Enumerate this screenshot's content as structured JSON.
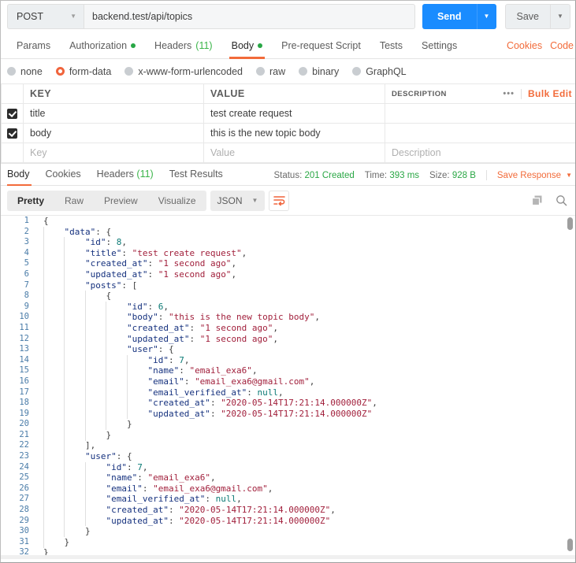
{
  "request": {
    "method": "POST",
    "url": "backend.test/api/topics",
    "send_label": "Send",
    "save_label": "Save",
    "tabs": [
      {
        "label": "Params",
        "active": false,
        "dot": false,
        "count": null
      },
      {
        "label": "Authorization",
        "active": false,
        "dot": true,
        "count": null
      },
      {
        "label": "Headers",
        "active": false,
        "dot": false,
        "count": "(11)"
      },
      {
        "label": "Body",
        "active": true,
        "dot": true,
        "count": null
      },
      {
        "label": "Pre-request Script",
        "active": false,
        "dot": false,
        "count": null
      },
      {
        "label": "Tests",
        "active": false,
        "dot": false,
        "count": null
      },
      {
        "label": "Settings",
        "active": false,
        "dot": false,
        "count": null
      }
    ],
    "links": [
      {
        "label": "Cookies"
      },
      {
        "label": "Code"
      }
    ],
    "body_types": [
      {
        "label": "none",
        "selected": false
      },
      {
        "label": "form-data",
        "selected": true
      },
      {
        "label": "x-www-form-urlencoded",
        "selected": false
      },
      {
        "label": "raw",
        "selected": false
      },
      {
        "label": "binary",
        "selected": false
      },
      {
        "label": "GraphQL",
        "selected": false
      }
    ],
    "table": {
      "headers": [
        "KEY",
        "VALUE",
        "DESCRIPTION"
      ],
      "bulk_edit_label": "Bulk Edit",
      "dots_label": "•••",
      "rows": [
        {
          "checked": true,
          "key": "title",
          "value": "test create request",
          "description": ""
        },
        {
          "checked": true,
          "key": "body",
          "value": "this is the new topic body",
          "description": ""
        }
      ],
      "placeholder_row": {
        "key": "Key",
        "value": "Value",
        "description": "Description"
      }
    }
  },
  "response": {
    "tabs": [
      {
        "label": "Body",
        "active": true,
        "count": null
      },
      {
        "label": "Cookies",
        "active": false,
        "count": null
      },
      {
        "label": "Headers",
        "active": false,
        "count": "(11)"
      },
      {
        "label": "Test Results",
        "active": false,
        "count": null
      }
    ],
    "meta": {
      "status_label": "Status:",
      "status_value": "201 Created",
      "time_label": "Time:",
      "time_value": "393 ms",
      "size_label": "Size:",
      "size_value": "928 B",
      "save_response_label": "Save Response"
    },
    "view_modes": [
      {
        "label": "Pretty",
        "active": true
      },
      {
        "label": "Raw",
        "active": false
      },
      {
        "label": "Preview",
        "active": false
      },
      {
        "label": "Visualize",
        "active": false
      }
    ],
    "format": "JSON",
    "code_lines": [
      {
        "n": 1,
        "indent": 0,
        "html": "<span class='tok-pun'>{</span>"
      },
      {
        "n": 2,
        "indent": 1,
        "html": "<span class='tok-key'>\"data\"</span><span class='tok-pun'>: {</span>"
      },
      {
        "n": 3,
        "indent": 2,
        "html": "<span class='tok-key'>\"id\"</span><span class='tok-pun'>: </span><span class='tok-num'>8</span><span class='tok-pun'>,</span>"
      },
      {
        "n": 4,
        "indent": 2,
        "html": "<span class='tok-key'>\"title\"</span><span class='tok-pun'>: </span><span class='tok-str'>\"test create request\"</span><span class='tok-pun'>,</span>"
      },
      {
        "n": 5,
        "indent": 2,
        "html": "<span class='tok-key'>\"created_at\"</span><span class='tok-pun'>: </span><span class='tok-str'>\"1 second ago\"</span><span class='tok-pun'>,</span>"
      },
      {
        "n": 6,
        "indent": 2,
        "html": "<span class='tok-key'>\"updated_at\"</span><span class='tok-pun'>: </span><span class='tok-str'>\"1 second ago\"</span><span class='tok-pun'>,</span>"
      },
      {
        "n": 7,
        "indent": 2,
        "html": "<span class='tok-key'>\"posts\"</span><span class='tok-pun'>: [</span>"
      },
      {
        "n": 8,
        "indent": 3,
        "html": "<span class='tok-pun'>{</span>"
      },
      {
        "n": 9,
        "indent": 4,
        "html": "<span class='tok-key'>\"id\"</span><span class='tok-pun'>: </span><span class='tok-num'>6</span><span class='tok-pun'>,</span>"
      },
      {
        "n": 10,
        "indent": 4,
        "html": "<span class='tok-key'>\"body\"</span><span class='tok-pun'>: </span><span class='tok-str'>\"this is the new topic body\"</span><span class='tok-pun'>,</span>"
      },
      {
        "n": 11,
        "indent": 4,
        "html": "<span class='tok-key'>\"created_at\"</span><span class='tok-pun'>: </span><span class='tok-str'>\"1 second ago\"</span><span class='tok-pun'>,</span>"
      },
      {
        "n": 12,
        "indent": 4,
        "html": "<span class='tok-key'>\"updated_at\"</span><span class='tok-pun'>: </span><span class='tok-str'>\"1 second ago\"</span><span class='tok-pun'>,</span>"
      },
      {
        "n": 13,
        "indent": 4,
        "html": "<span class='tok-key'>\"user\"</span><span class='tok-pun'>: {</span>"
      },
      {
        "n": 14,
        "indent": 5,
        "html": "<span class='tok-key'>\"id\"</span><span class='tok-pun'>: </span><span class='tok-num'>7</span><span class='tok-pun'>,</span>"
      },
      {
        "n": 15,
        "indent": 5,
        "html": "<span class='tok-key'>\"name\"</span><span class='tok-pun'>: </span><span class='tok-str'>\"email_exa6\"</span><span class='tok-pun'>,</span>"
      },
      {
        "n": 16,
        "indent": 5,
        "html": "<span class='tok-key'>\"email\"</span><span class='tok-pun'>: </span><span class='tok-str'>\"email_exa6@gmail.com\"</span><span class='tok-pun'>,</span>"
      },
      {
        "n": 17,
        "indent": 5,
        "html": "<span class='tok-key'>\"email_verified_at\"</span><span class='tok-pun'>: </span><span class='tok-null'>null</span><span class='tok-pun'>,</span>"
      },
      {
        "n": 18,
        "indent": 5,
        "html": "<span class='tok-key'>\"created_at\"</span><span class='tok-pun'>: </span><span class='tok-str'>\"2020-05-14T17:21:14.000000Z\"</span><span class='tok-pun'>,</span>"
      },
      {
        "n": 19,
        "indent": 5,
        "html": "<span class='tok-key'>\"updated_at\"</span><span class='tok-pun'>: </span><span class='tok-str'>\"2020-05-14T17:21:14.000000Z\"</span>"
      },
      {
        "n": 20,
        "indent": 4,
        "html": "<span class='tok-pun'>}</span>"
      },
      {
        "n": 21,
        "indent": 3,
        "html": "<span class='tok-pun'>}</span>"
      },
      {
        "n": 22,
        "indent": 2,
        "html": "<span class='tok-pun'>],</span>"
      },
      {
        "n": 23,
        "indent": 2,
        "html": "<span class='tok-key'>\"user\"</span><span class='tok-pun'>: {</span>"
      },
      {
        "n": 24,
        "indent": 3,
        "html": "<span class='tok-key'>\"id\"</span><span class='tok-pun'>: </span><span class='tok-num'>7</span><span class='tok-pun'>,</span>"
      },
      {
        "n": 25,
        "indent": 3,
        "html": "<span class='tok-key'>\"name\"</span><span class='tok-pun'>: </span><span class='tok-str'>\"email_exa6\"</span><span class='tok-pun'>,</span>"
      },
      {
        "n": 26,
        "indent": 3,
        "html": "<span class='tok-key'>\"email\"</span><span class='tok-pun'>: </span><span class='tok-str'>\"email_exa6@gmail.com\"</span><span class='tok-pun'>,</span>"
      },
      {
        "n": 27,
        "indent": 3,
        "html": "<span class='tok-key'>\"email_verified_at\"</span><span class='tok-pun'>: </span><span class='tok-null'>null</span><span class='tok-pun'>,</span>"
      },
      {
        "n": 28,
        "indent": 3,
        "html": "<span class='tok-key'>\"created_at\"</span><span class='tok-pun'>: </span><span class='tok-str'>\"2020-05-14T17:21:14.000000Z\"</span><span class='tok-pun'>,</span>"
      },
      {
        "n": 29,
        "indent": 3,
        "html": "<span class='tok-key'>\"updated_at\"</span><span class='tok-pun'>: </span><span class='tok-str'>\"2020-05-14T17:21:14.000000Z\"</span>"
      },
      {
        "n": 30,
        "indent": 2,
        "html": "<span class='tok-pun'>}</span>"
      },
      {
        "n": 31,
        "indent": 1,
        "html": "<span class='tok-pun'>}</span>"
      },
      {
        "n": 32,
        "indent": 0,
        "html": "<span class='tok-pun'>}</span>"
      }
    ]
  }
}
